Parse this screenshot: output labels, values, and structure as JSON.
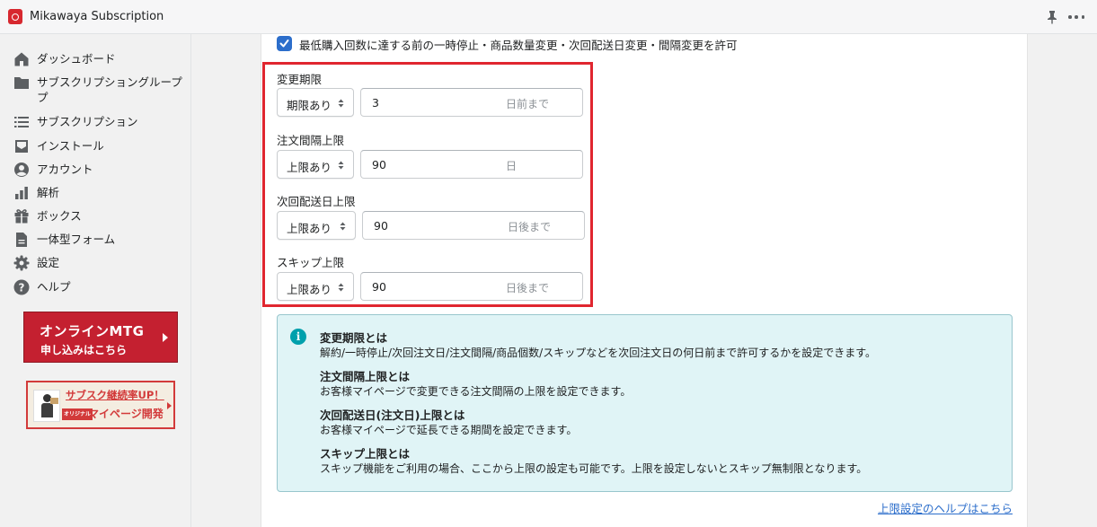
{
  "app": {
    "title": "Mikawaya Subscription",
    "icon": "shopping-bag-icon",
    "accent_color": "#d7282f"
  },
  "topbar": {
    "pin_icon": "pin-icon",
    "more_icon": "more-horizontal-icon"
  },
  "sidebar": {
    "items": [
      {
        "label": "ダッシュボード",
        "icon": "home-icon"
      },
      {
        "label": "サブスクリプショングループ",
        "label_line2": "プ",
        "icon": "folder-icon"
      },
      {
        "label": "サブスクリプション",
        "icon": "list-icon"
      },
      {
        "label": "インストール",
        "icon": "inbox-icon"
      },
      {
        "label": "アカウント",
        "icon": "user-circle-icon"
      },
      {
        "label": "解析",
        "icon": "bar-chart-icon"
      },
      {
        "label": "ボックス",
        "icon": "gift-icon"
      },
      {
        "label": "一体型フォーム",
        "icon": "document-icon"
      },
      {
        "label": "設定",
        "icon": "gear-icon"
      },
      {
        "label": "ヘルプ",
        "icon": "question-circle-icon"
      }
    ],
    "banner_mtg": {
      "title": "オンラインMTG",
      "subtitle": "申し込みはこちら",
      "color": "#c42030"
    },
    "banner_mypage": {
      "title": "サブスク継続率UP！",
      "tag": "オリジナル",
      "subtitle": "マイページ開発",
      "color": "#d23a3a"
    }
  },
  "main": {
    "permission_checkbox": {
      "checked": true,
      "label": "最低購入回数に達する前の一時停止・商品数量変更・次回配送日変更・間隔変更を許可"
    },
    "fields": [
      {
        "label": "変更期限",
        "select": "期限あり",
        "value": "3",
        "suffix": "日前まで"
      },
      {
        "label": "注文間隔上限",
        "select": "上限あり",
        "value": "90",
        "suffix": "日"
      },
      {
        "label": "次回配送日上限",
        "select": "上限あり",
        "value": "90",
        "suffix": "日後まで"
      },
      {
        "label": "スキップ上限",
        "select": "上限あり",
        "value": "90",
        "suffix": "日後まで"
      }
    ],
    "info": {
      "icon": "info-icon",
      "items": [
        {
          "heading": "変更期限とは",
          "text": "解約/一時停止/次回注文日/注文間隔/商品個数/スキップなどを次回注文日の何日前まで許可するかを設定できます。"
        },
        {
          "heading": "注文間隔上限とは",
          "text": "お客様マイページで変更できる注文間隔の上限を設定できます。"
        },
        {
          "heading": "次回配送日(注文日)上限とは",
          "text": "お客様マイページで延長できる期間を設定できます。"
        },
        {
          "heading": "スキップ上限とは",
          "text": "スキップ機能をご利用の場合、ここから上限の設定も可能です。上限を設定しないとスキップ無制限となります。"
        }
      ]
    },
    "help_link": "上限設定のヘルプはこちら",
    "highlight_color": "#e0262f",
    "info_bg_color": "#e0f4f6",
    "link_color": "#2c6ecb"
  }
}
